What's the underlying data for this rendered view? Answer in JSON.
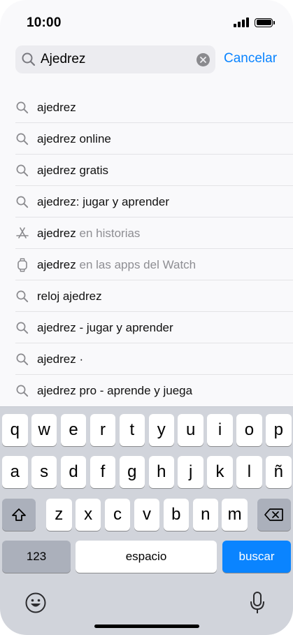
{
  "status": {
    "time": "10:00"
  },
  "search": {
    "value": "Ajedrez",
    "cancel_label": "Cancelar"
  },
  "suggestions": [
    {
      "icon": "search-icon",
      "text": "ajedrez",
      "hint": ""
    },
    {
      "icon": "search-icon",
      "text": "ajedrez online",
      "hint": ""
    },
    {
      "icon": "search-icon",
      "text": "ajedrez gratis",
      "hint": ""
    },
    {
      "icon": "search-icon",
      "text": "ajedrez: jugar y aprender",
      "hint": ""
    },
    {
      "icon": "app-store-icon",
      "text": "ajedrez",
      "hint": " en historias"
    },
    {
      "icon": "watch-icon",
      "text": "ajedrez",
      "hint": " en las apps del Watch"
    },
    {
      "icon": "search-icon",
      "text": "reloj ajedrez",
      "hint": ""
    },
    {
      "icon": "search-icon",
      "text": "ajedrez - jugar y aprender",
      "hint": ""
    },
    {
      "icon": "search-icon",
      "text": "ajedrez ·",
      "hint": ""
    },
    {
      "icon": "search-icon",
      "text": "ajedrez pro - aprende y juega",
      "hint": ""
    }
  ],
  "keyboard": {
    "row1": [
      "q",
      "w",
      "e",
      "r",
      "t",
      "y",
      "u",
      "i",
      "o",
      "p"
    ],
    "row2": [
      "a",
      "s",
      "d",
      "f",
      "g",
      "h",
      "j",
      "k",
      "l",
      "ñ"
    ],
    "row3": [
      "z",
      "x",
      "c",
      "v",
      "b",
      "n",
      "m"
    ],
    "numbers_label": "123",
    "space_label": "espacio",
    "search_label": "buscar"
  },
  "colors": {
    "accent": "#0a84ff",
    "keyboard_bg": "#d1d4db",
    "function_key": "#abb0bb"
  }
}
